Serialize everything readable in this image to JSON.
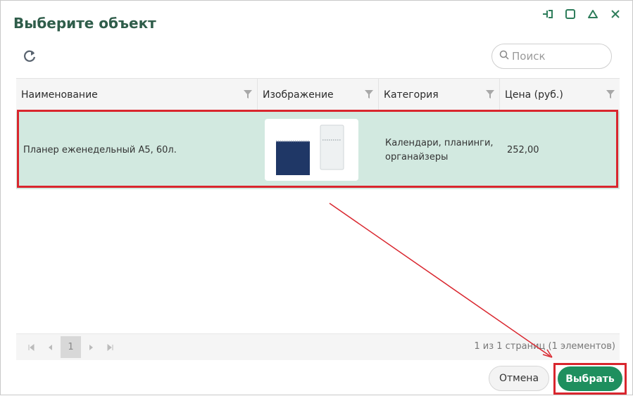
{
  "dialog": {
    "title": "Выберите объект"
  },
  "search": {
    "placeholder": "Поиск"
  },
  "table": {
    "columns": [
      "Наименование",
      "Изображение",
      "Категория",
      "Цена (руб.)"
    ],
    "rows": [
      {
        "name": "Планер еженедельный А5, 60л.",
        "category": "Календари, планинги, органайзеры",
        "price": "252,00"
      }
    ]
  },
  "pager": {
    "current_page": "1",
    "info": "1 из 1 страниц (1 элементов)"
  },
  "buttons": {
    "cancel": "Отмена",
    "select": "Выбрать"
  },
  "colors": {
    "title": "#2f5d4a",
    "selected_row": "#d2e9e0",
    "primary_button": "#1e8f5e",
    "highlight": "#d9262e"
  },
  "icons": [
    "pin-icon",
    "maximize-icon",
    "collapse-icon",
    "close-icon",
    "refresh-icon",
    "search-icon",
    "filter-icon"
  ]
}
